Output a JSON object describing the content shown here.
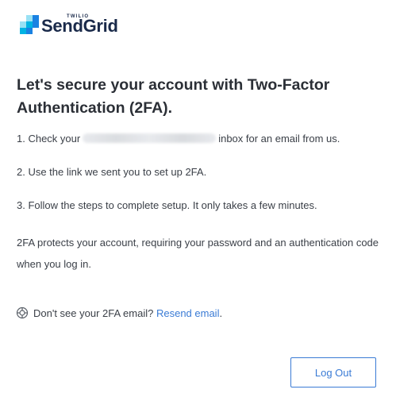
{
  "brand": {
    "super_label": "TWILIO",
    "name": "SendGrid",
    "colors": {
      "dark_blue": "#1a82e2",
      "light_blue": "#99e1f4",
      "mid_blue": "#00b3e3",
      "navy": "#1a2a4a"
    }
  },
  "heading": "Let's secure your account with Two-Factor Authentication (2FA).",
  "steps": {
    "step1_prefix": "1. Check your",
    "step1_suffix": "inbox for an email from us.",
    "step2": "2. Use the link we sent you to set up 2FA.",
    "step3": "3. Follow the steps to complete setup. It only takes a few minutes."
  },
  "info": "2FA protects your account, requiring your password and an authentication code when you log in.",
  "resend": {
    "prompt": "Don't see your 2FA email?",
    "link_label": "Resend email",
    "suffix": "."
  },
  "logout_label": "Log Out",
  "colors": {
    "accent": "#3a7bd5",
    "text": "#3a3f47",
    "heading": "#2b2f36"
  }
}
